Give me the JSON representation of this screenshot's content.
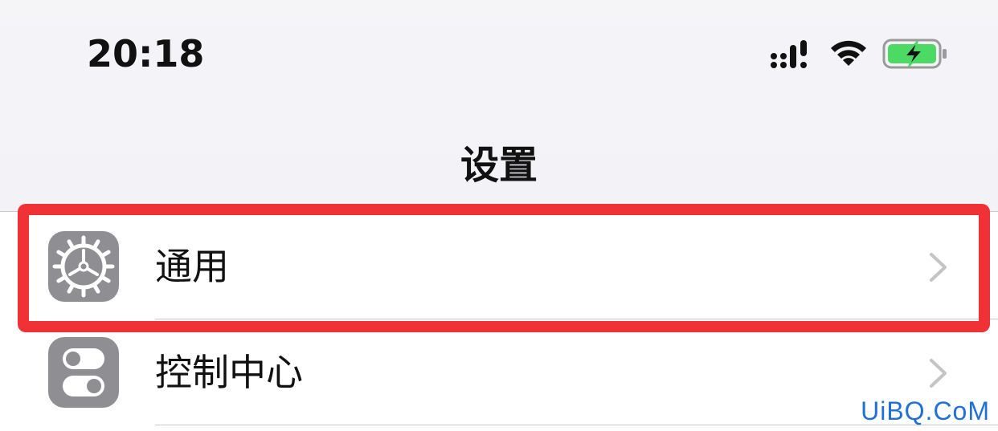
{
  "status_bar": {
    "time": "20:18",
    "signal_icon": "cellular-signal-icon",
    "wifi_icon": "wifi-icon",
    "battery_icon": "battery-charging-icon",
    "battery_color": "#4cd964"
  },
  "nav": {
    "title": "设置"
  },
  "settings_list": [
    {
      "label": "通用",
      "icon": "gear-icon",
      "highlighted": true
    },
    {
      "label": "控制中心",
      "icon": "toggle-switches-icon",
      "highlighted": false
    }
  ],
  "highlight": {
    "color": "#f03236"
  },
  "watermark": {
    "text": "UiBQ.CoM",
    "color": "#1f6fd8"
  }
}
